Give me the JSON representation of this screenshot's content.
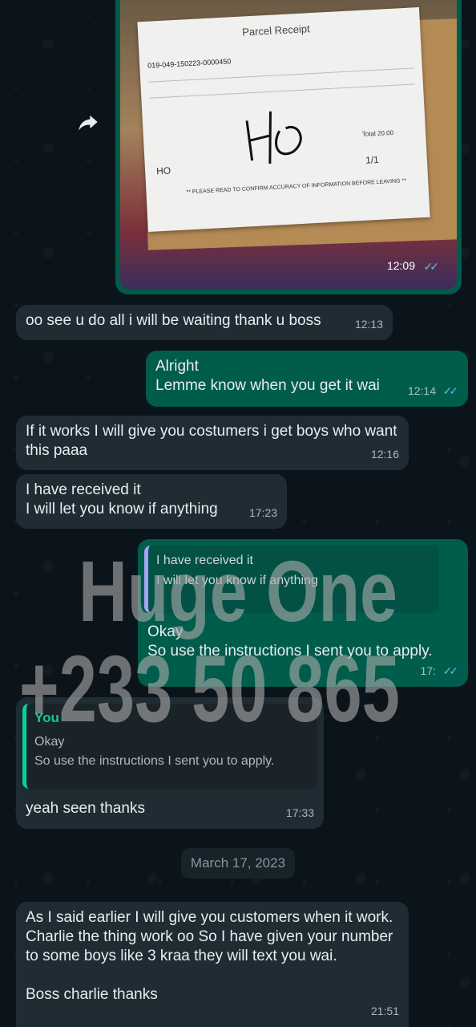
{
  "image_message": {
    "receipt_title": "Parcel Receipt",
    "receipt_code": "019-049-150223-0000450",
    "receipt_total_label": "Total",
    "receipt_total_value": "20.00",
    "receipt_page": "1/1",
    "receipt_footer_initials": "HO",
    "receipt_note": "** PLEASE READ TO CONFIRM ACCURACY OF INFORMATION BEFORE LEAVING **",
    "signature_text": "HO",
    "time": "12:09",
    "status": "read"
  },
  "messages": [
    {
      "dir": "in",
      "text": "oo see u do all i will be waiting thank u boss",
      "time": "12:13"
    },
    {
      "dir": "out",
      "text": "Alright\nLemme know when you get it wai",
      "time": "12:14",
      "status": "read"
    },
    {
      "dir": "in",
      "text": "If it works I will give you costumers i get boys who want this paaa",
      "time": "12:16"
    },
    {
      "dir": "in",
      "text": "I have received it\nI will let you know if anything",
      "time": "17:23"
    },
    {
      "dir": "out",
      "quoted_text": "I have received it\nI will let you know if anything",
      "text": "Okay\nSo use the instructions I sent you to apply.",
      "time": "17:"
    },
    {
      "dir": "in",
      "quoted_author": "You",
      "quoted_text": "Okay\nSo use the instructions I sent you to apply.",
      "text": "yeah seen thanks",
      "time": "17:33"
    },
    {
      "dir": "in",
      "text": "As I said earlier I will give you customers when it work. Charlie the thing work oo So I have given your number to some boys like 3 kraa they will text you wai.\n\nBoss charlie thanks",
      "time": "21:51"
    }
  ],
  "date_separator": "March 17, 2023",
  "watermark": {
    "line1": "Huge One",
    "line2": "+233 50 865"
  },
  "colors": {
    "background": "#0b141a",
    "incoming": "#202c33",
    "outgoing": "#005c4b",
    "accent": "#06cf9c",
    "ticks": "#53bdeb"
  },
  "icons": {
    "forward": "forward-arrow-icon",
    "read": "double-check-icon"
  }
}
